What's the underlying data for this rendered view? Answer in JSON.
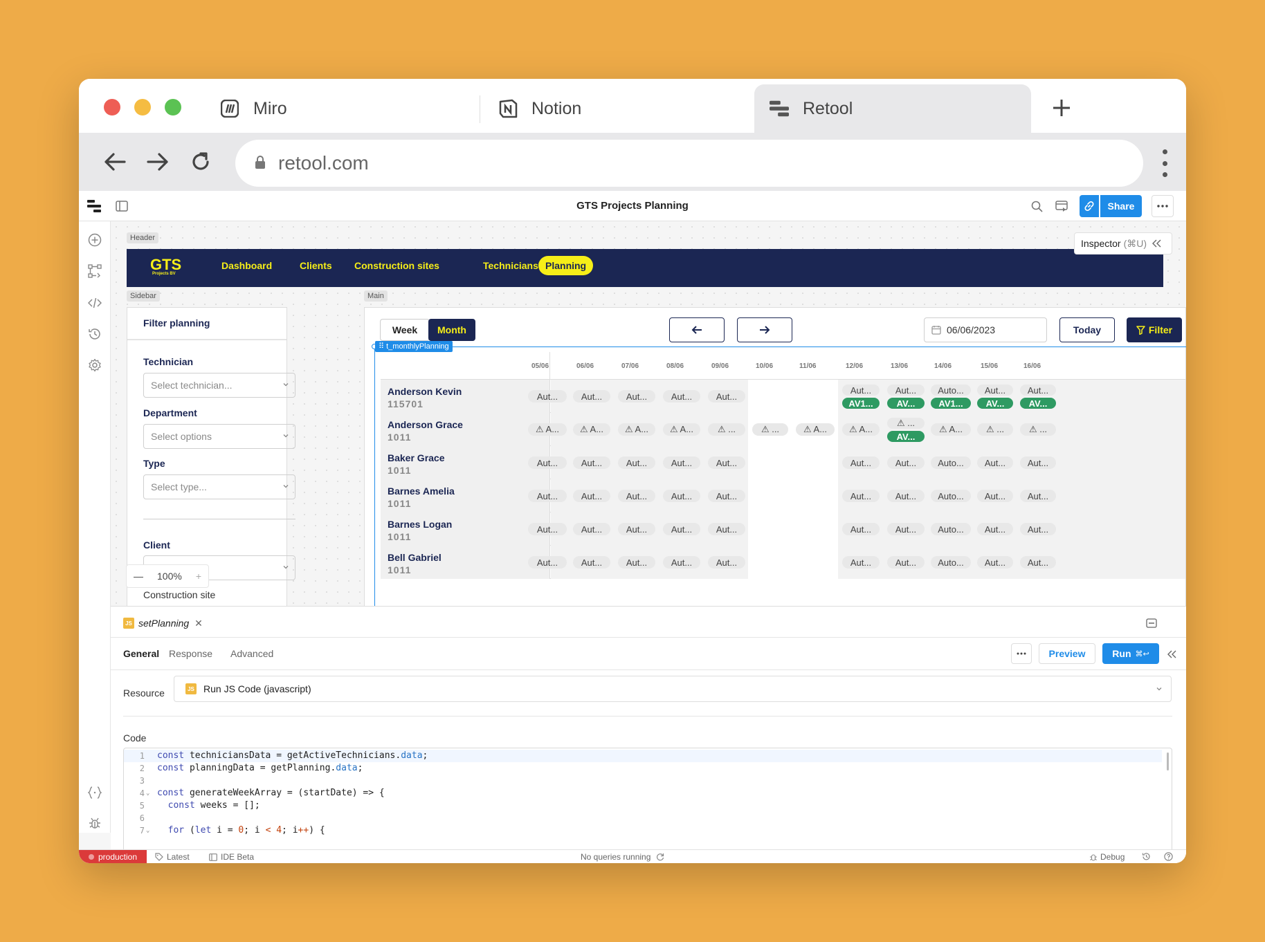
{
  "browser": {
    "tabs": [
      {
        "label": "Miro",
        "icon": "miro-icon"
      },
      {
        "label": "Notion",
        "icon": "notion-icon"
      },
      {
        "label": "Retool",
        "icon": "retool-icon"
      }
    ],
    "url": "retool.com"
  },
  "app": {
    "title": "GTS Projects Planning",
    "share_label": "Share",
    "inspector_label": "Inspector",
    "inspector_shortcut": "(⌘U)"
  },
  "frames": {
    "header": "Header",
    "sidebar": "Sidebar",
    "main": "Main"
  },
  "header": {
    "logo_text": "GTS",
    "logo_sub": "Projects BV",
    "nav": [
      "Dashboard",
      "Clients",
      "Construction sites",
      "Technicians",
      "Planning"
    ],
    "active_nav": "Planning"
  },
  "sidebar": {
    "title": "Filter planning",
    "technician_label": "Technician",
    "technician_placeholder": "Select technician...",
    "department_label": "Department",
    "department_placeholder": "Select options",
    "type_label": "Type",
    "type_placeholder": "Select type...",
    "client_label": "Client",
    "construction_label": "Construction site",
    "zoom": "100%"
  },
  "main": {
    "view_week": "Week",
    "view_month": "Month",
    "active_view": "Month",
    "date_value": "06/06/2023",
    "today_label": "Today",
    "filter_label": "Filter",
    "component_name": "t_monthlyPlanning",
    "columns": [
      "05/06",
      "06/06",
      "07/06",
      "08/06",
      "09/06",
      "10/06",
      "11/06",
      "12/06",
      "13/06",
      "14/06",
      "15/06",
      "16/06"
    ],
    "rows": [
      {
        "name": "Anderson Kevin",
        "id": "115701",
        "cells": [
          [
            "Aut..."
          ],
          [
            "Aut..."
          ],
          [
            "Aut..."
          ],
          [
            "Aut..."
          ],
          [
            "Aut..."
          ],
          [],
          [],
          [
            "Aut...",
            "AV1..."
          ],
          [
            "Aut...",
            "AV..."
          ],
          [
            "Auto...",
            "AV1..."
          ],
          [
            "Aut...",
            "AV..."
          ],
          [
            "Aut...",
            "AV..."
          ]
        ]
      },
      {
        "name": "Anderson Grace",
        "id": "1011",
        "cells": [
          [
            "⚠ A..."
          ],
          [
            "⚠ A..."
          ],
          [
            "⚠ A..."
          ],
          [
            "⚠ A..."
          ],
          [
            "⚠ ..."
          ],
          [
            "⚠ ..."
          ],
          [
            "⚠ A..."
          ],
          [
            "⚠ A..."
          ],
          [
            "⚠ ...",
            "AV..."
          ],
          [
            "⚠ A..."
          ],
          [
            "⚠ ..."
          ],
          [
            "⚠ ..."
          ]
        ]
      },
      {
        "name": "Baker Grace",
        "id": "1011",
        "cells": [
          [
            "Aut..."
          ],
          [
            "Aut..."
          ],
          [
            "Aut..."
          ],
          [
            "Aut..."
          ],
          [
            "Aut..."
          ],
          [],
          [],
          [
            "Aut..."
          ],
          [
            "Aut..."
          ],
          [
            "Auto..."
          ],
          [
            "Aut..."
          ],
          [
            "Aut..."
          ]
        ]
      },
      {
        "name": "Barnes Amelia",
        "id": "1011",
        "cells": [
          [
            "Aut..."
          ],
          [
            "Aut..."
          ],
          [
            "Aut..."
          ],
          [
            "Aut..."
          ],
          [
            "Aut..."
          ],
          [],
          [],
          [
            "Aut..."
          ],
          [
            "Aut..."
          ],
          [
            "Auto..."
          ],
          [
            "Aut..."
          ],
          [
            "Aut..."
          ]
        ]
      },
      {
        "name": "Barnes Logan",
        "id": "1011",
        "cells": [
          [
            "Aut..."
          ],
          [
            "Aut..."
          ],
          [
            "Aut..."
          ],
          [
            "Aut..."
          ],
          [
            "Aut..."
          ],
          [],
          [],
          [
            "Aut..."
          ],
          [
            "Aut..."
          ],
          [
            "Auto..."
          ],
          [
            "Aut..."
          ],
          [
            "Aut..."
          ]
        ]
      },
      {
        "name": "Bell Gabriel",
        "id": "1011",
        "cells": [
          [
            "Aut..."
          ],
          [
            "Aut..."
          ],
          [
            "Aut..."
          ],
          [
            "Aut..."
          ],
          [
            "Aut..."
          ],
          [],
          [],
          [
            "Aut..."
          ],
          [
            "Aut..."
          ],
          [
            "Auto..."
          ],
          [
            "Aut..."
          ],
          [
            "Aut..."
          ]
        ]
      }
    ]
  },
  "query": {
    "name": "setPlanning",
    "tabs": [
      "General",
      "Response",
      "Advanced"
    ],
    "active_tab": "General",
    "preview_label": "Preview",
    "run_label": "Run",
    "run_shortcut": "⌘↩",
    "resource_label": "Resource",
    "resource_value": "Run JS Code (javascript)",
    "code_label": "Code",
    "code_lines": [
      "const techniciansData = getActiveTechnicians.data;",
      "const planningData = getPlanning.data;",
      "",
      "const generateWeekArray = (startDate) => {",
      "  const weeks = [];",
      "",
      "  for (let i = 0; i < 4; i++) {"
    ]
  },
  "statusbar": {
    "env": "production",
    "version": "Latest",
    "ide": "IDE Beta",
    "queries": "No queries running",
    "debug": "Debug"
  },
  "colors": {
    "navy": "#1B2653",
    "yellow": "#F6EE18",
    "retool_blue": "#1F8CE8",
    "green": "#2E9A62",
    "background": "#EEAB48"
  }
}
